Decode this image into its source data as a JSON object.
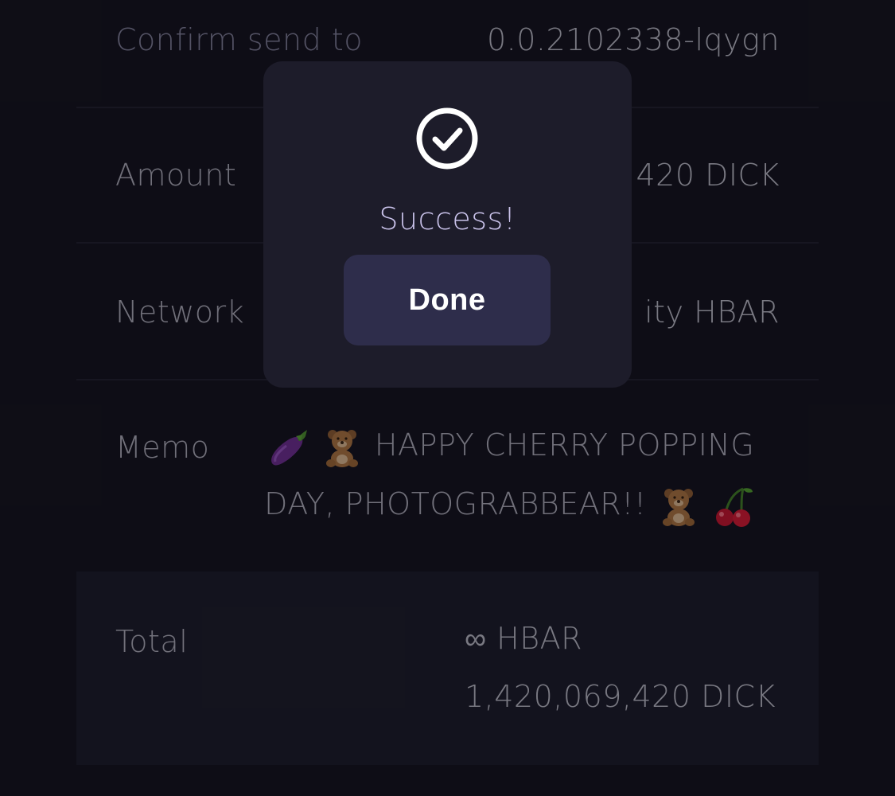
{
  "confirm": {
    "label": "Confirm send to",
    "value": "0.0.2102338-lqygn"
  },
  "amount": {
    "label": "Amount",
    "value": "420 DICK"
  },
  "network": {
    "label": "Network",
    "value": "ity HBAR"
  },
  "memo": {
    "label": "Memo",
    "text_line1": "HAPPY CHERRY POPPING",
    "text_line2": "DAY, PHOTOGRABBEAR!!",
    "icons": [
      "eggplant-emoji",
      "teddy-bear-emoji",
      "teddy-bear-emoji",
      "cherries-emoji"
    ]
  },
  "total": {
    "label": "Total",
    "hbar": "∞ HBAR",
    "dick": "1,420,069,420 DICK"
  },
  "modal": {
    "icon": "check-circle-icon",
    "message": "Success!",
    "done_label": "Done"
  },
  "colors": {
    "background": "#111019",
    "modal": "#1d1c2a",
    "button": "#2e2d4b",
    "success_text": "#c9c2ea",
    "total_panel": "#1a1a26"
  }
}
